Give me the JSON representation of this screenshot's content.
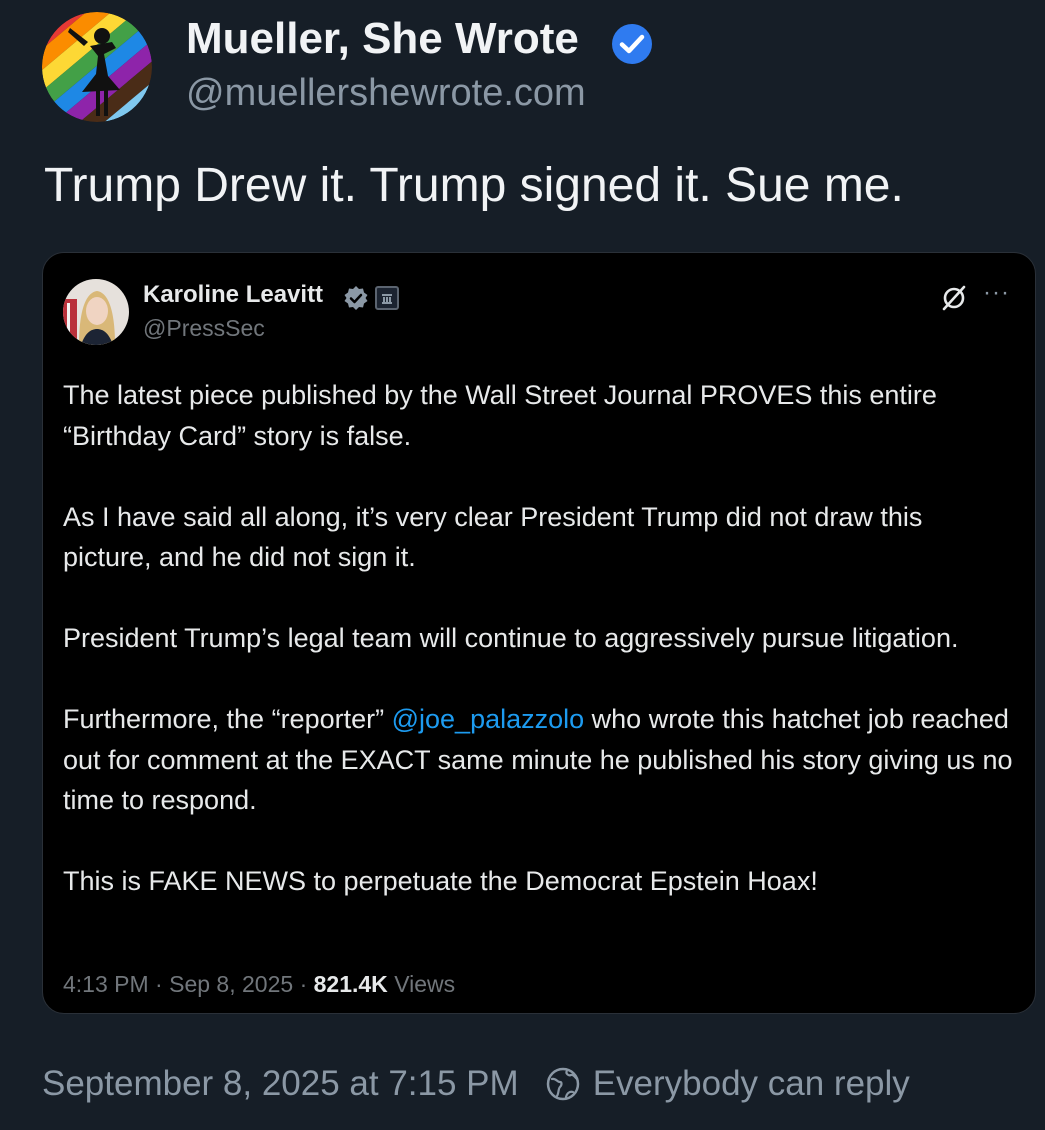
{
  "post": {
    "display_name": "Mueller, She Wrote",
    "handle": "@muellershewrote.com",
    "text": "Trump Drew it. Trump signed it. Sue me.",
    "timestamp": "September 8, 2025 at 7:15 PM",
    "reply_setting": "Everybody can reply"
  },
  "quoted": {
    "name": "Karoline Leavitt",
    "handle": "@PressSec",
    "paragraph1": "The latest piece published by the Wall Street Journal PROVES this entire “Birthday Card” story is false.",
    "paragraph2": "As I have said all along, it’s very clear President Trump did not draw this picture, and he did not sign it.",
    "paragraph3": "President Trump’s legal team will continue to aggressively pursue litigation.",
    "paragraph4_before": "Furthermore, the “reporter” ",
    "paragraph4_mention": "@joe_palazzolo",
    "paragraph4_after": " who wrote this hatchet job reached out for comment at the EXACT same minute he published his story giving us no time to respond.",
    "paragraph5": "This is FAKE NEWS to perpetuate the Democrat Epstein Hoax!",
    "time": "4:13 PM",
    "date": "Sep 8, 2025",
    "separator": "·",
    "views_count": "821.4K",
    "views_label": "Views"
  },
  "icons": {
    "verified_main": "verified-badge-icon",
    "verified_quoted": "verified-badge-icon",
    "government": "government-building-icon",
    "grok": "grok-icon",
    "more": "more-icon",
    "globe": "globe-icon"
  },
  "colors": {
    "background": "#161e27",
    "card_background": "#000000",
    "accent": "#1d9bf0",
    "verified_main": "#2f7bf0",
    "muted_text": "#8b98a5"
  }
}
